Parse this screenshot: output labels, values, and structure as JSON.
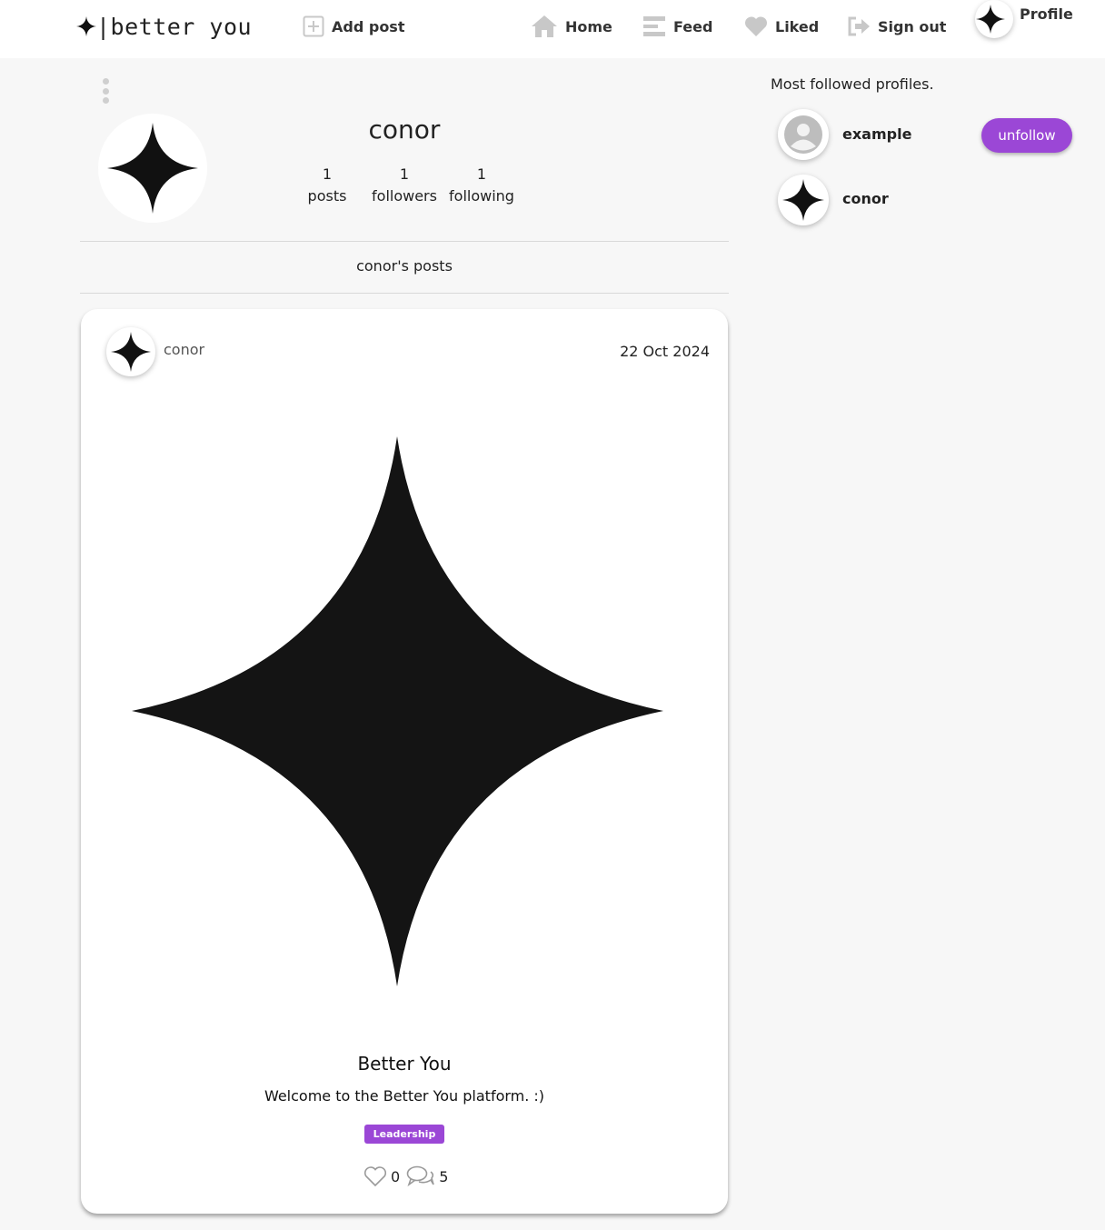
{
  "brand": {
    "logo_text": "|better you"
  },
  "nav": {
    "add_post": "Add post",
    "home": "Home",
    "feed": "Feed",
    "liked": "Liked",
    "sign_out": "Sign out",
    "profile": "Profile"
  },
  "profile": {
    "username": "conor",
    "stats": [
      {
        "value": "1",
        "label": "posts"
      },
      {
        "value": "1",
        "label": "followers"
      },
      {
        "value": "1",
        "label": "following"
      }
    ],
    "posts_heading": "conor's posts"
  },
  "post": {
    "author": "conor",
    "date": "22 Oct 2024",
    "title": "Better You",
    "body": "Welcome to the Better You platform. :)",
    "tag": "Leadership",
    "likes": "0",
    "comments": "5"
  },
  "sidebar": {
    "title": "Most followed profiles.",
    "profiles": [
      {
        "name": "example",
        "button": "unfollow"
      },
      {
        "name": "conor"
      }
    ]
  },
  "colors": {
    "accent": "#9b47d6",
    "icon_gray": "#c8c8c8",
    "background": "#f7f7f7"
  }
}
